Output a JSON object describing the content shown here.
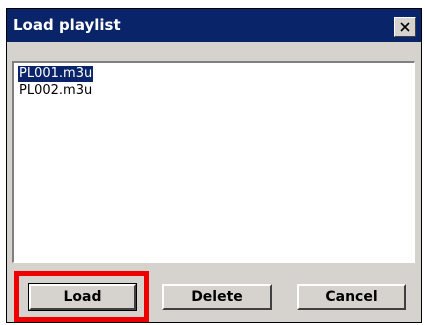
{
  "dialog": {
    "title": "Load playlist",
    "close_icon": "close-icon"
  },
  "playlist": {
    "items": [
      {
        "label": "PL001.m3u",
        "selected": true
      },
      {
        "label": "PL002.m3u",
        "selected": false
      }
    ]
  },
  "buttons": {
    "load_label": "Load",
    "delete_label": "Delete",
    "cancel_label": "Cancel"
  },
  "colors": {
    "titlebar": "#0a246a",
    "face": "#d6d3ce",
    "selection": "#0a246a",
    "highlight": "#ee0000"
  }
}
